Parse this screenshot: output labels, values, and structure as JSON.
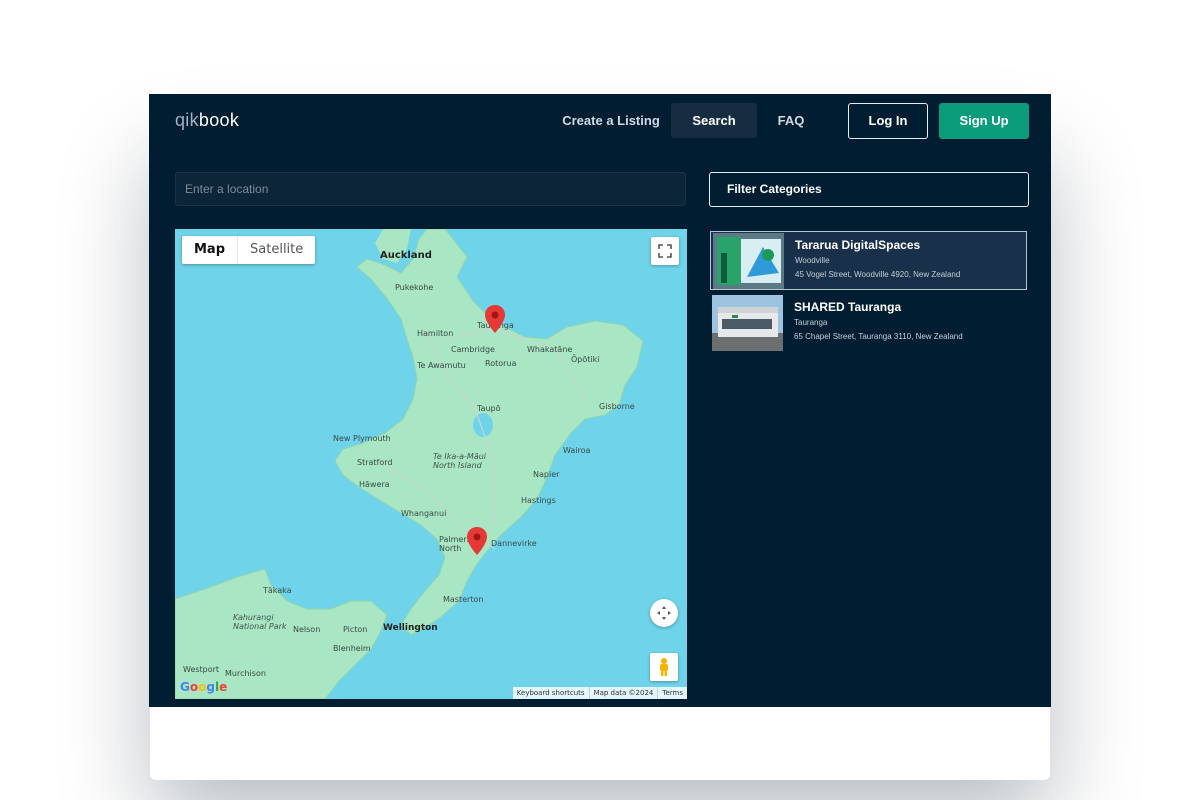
{
  "header": {
    "logo_prefix": "qik",
    "logo_suffix": "book",
    "nav": {
      "create_listing": "Create a Listing",
      "search": "Search",
      "faq": "FAQ"
    },
    "login": "Log In",
    "signup": "Sign Up"
  },
  "search": {
    "placeholder": "Enter a location",
    "value": ""
  },
  "filter": {
    "label": "Filter Categories"
  },
  "map": {
    "type_map": "Map",
    "type_satellite": "Satellite",
    "logo": "Google",
    "footer": [
      "Keyboard shortcuts",
      "Map data ©2024",
      "Terms"
    ],
    "colors": {
      "water": "#6fd3e9",
      "land": "#a9e6c4",
      "marker": "#e53935"
    },
    "labels": {
      "auckland": "Auckland",
      "pukekohe": "Pukekohe",
      "hamilton": "Hamilton",
      "tauranga": "Tauranga",
      "cambridge": "Cambridge",
      "whakatane": "Whakatāne",
      "opotiki": "Ōpōtiki",
      "te_awamutu": "Te Awamutu",
      "rotorua": "Rotorua",
      "taupo": "Taupō",
      "gisborne": "Gisborne",
      "new_plymouth": "New Plymouth",
      "wairoa": "Wairoa",
      "stratford": "Stratford",
      "north_island": "Te Ika-a-Māui\nNorth Island",
      "napier": "Napier",
      "hawera": "Hāwera",
      "hastings": "Hastings",
      "whanganui": "Whanganui",
      "palmerston": "Palmerston\nNorth",
      "dannevirke": "Dannevirke",
      "masterton": "Masterton",
      "takaka": "Tākaka",
      "kahurangi": "Kahurangi\nNational Park",
      "nelson": "Nelson",
      "picton": "Picton",
      "wellington": "Wellington",
      "blenheim": "Blenheim",
      "westport": "Westport",
      "murchison": "Murchison"
    }
  },
  "listings": [
    {
      "title": "Tararua DigitalSpaces",
      "city": "Woodville",
      "address": "45 Vogel Street, Woodville 4920, New Zealand",
      "selected": true
    },
    {
      "title": "SHARED Tauranga",
      "city": "Tauranga",
      "address": "65 Chapel Street, Tauranga 3110, New Zealand",
      "selected": false
    }
  ]
}
